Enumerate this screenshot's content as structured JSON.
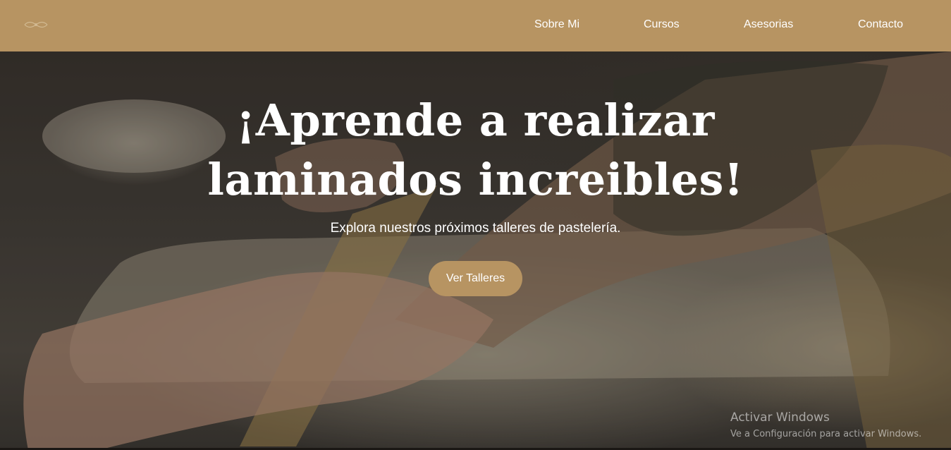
{
  "nav": {
    "links": [
      {
        "label": "Sobre Mi"
      },
      {
        "label": "Cursos"
      },
      {
        "label": "Asesorias"
      },
      {
        "label": "Contacto"
      }
    ],
    "logo_icon": "ornament-logo-icon",
    "background": "#b79462"
  },
  "hero": {
    "title_line1": "¡Aprende a realizar",
    "title_line2": "laminados increibles!",
    "subtitle": "Explora nuestros próximos talleres de pastelería.",
    "button_label": "Ver Talleres",
    "button_color": "#b79462"
  },
  "windows_watermark": {
    "title": "Activar Windows",
    "subtitle": "Ve a Configuración para activar Windows."
  }
}
